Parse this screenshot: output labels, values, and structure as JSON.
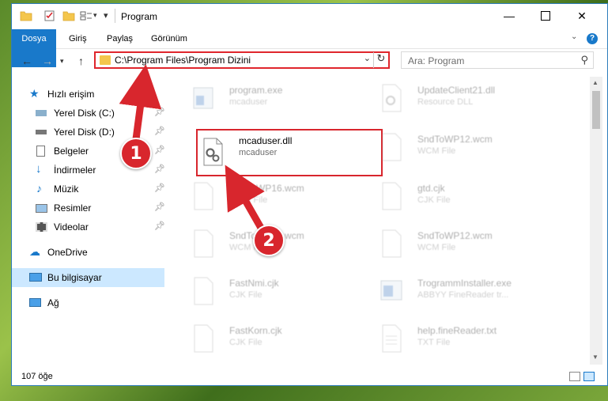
{
  "window": {
    "title": "Program"
  },
  "ribbon": {
    "tabs": [
      "Dosya",
      "Giriş",
      "Paylaş",
      "Görünüm"
    ]
  },
  "address": {
    "path": "C:\\Program Files\\Program Dizini"
  },
  "search": {
    "placeholder": "Ara: Program"
  },
  "sidebar": {
    "items": [
      {
        "label": "Hızlı erişim",
        "icon": "star-icon",
        "pinned": false
      },
      {
        "label": "Yerel Disk (C:)",
        "icon": "drive-icon",
        "pinned": true
      },
      {
        "label": "Yerel Disk (D:)",
        "icon": "drive-icon",
        "pinned": true
      },
      {
        "label": "Belgeler",
        "icon": "documents-icon",
        "pinned": true
      },
      {
        "label": "İndirmeler",
        "icon": "download-icon",
        "pinned": true
      },
      {
        "label": "Müzik",
        "icon": "music-icon",
        "pinned": true
      },
      {
        "label": "Resimler",
        "icon": "pictures-icon",
        "pinned": true
      },
      {
        "label": "Videolar",
        "icon": "videos-icon",
        "pinned": true
      },
      {
        "label": "OneDrive",
        "icon": "cloud-icon",
        "pinned": false
      },
      {
        "label": "Bu bilgisayar",
        "icon": "computer-icon",
        "pinned": false,
        "selected": true
      },
      {
        "label": "Ağ",
        "icon": "network-icon",
        "pinned": false
      }
    ]
  },
  "files": [
    {
      "name": "program.exe",
      "type": "mcaduser",
      "faded": true,
      "icon": "exe-icon"
    },
    {
      "name": "UpdateClient21.dll",
      "type": "Resource DLL",
      "faded": true,
      "icon": "dll-icon"
    },
    {
      "name": "mcaduser.dll",
      "type": "mcaduser",
      "faded": false,
      "highlight": true,
      "icon": "dll-icon"
    },
    {
      "name": "SndToWP12.wcm",
      "type": "WCM File",
      "faded": true,
      "icon": "file-icon"
    },
    {
      "name": "SndToWP16.wcm",
      "type": "WCM File",
      "faded": true,
      "icon": "file-icon"
    },
    {
      "name": "gtd.cjk",
      "type": "CJK File",
      "faded": true,
      "icon": "file-icon"
    },
    {
      "name": "SndToWP12.wcm",
      "type": "WCM File",
      "faded": true,
      "icon": "file-icon"
    },
    {
      "name": "SndToWP12.wcm",
      "type": "WCM File",
      "faded": true,
      "icon": "file-icon"
    },
    {
      "name": "FastNmi.cjk",
      "type": "CJK File",
      "faded": true,
      "icon": "file-icon"
    },
    {
      "name": "TrogrammInstaller.exe",
      "type": "ABBYY FineReader tr...",
      "faded": true,
      "icon": "exe-icon"
    },
    {
      "name": "FastKorn.cjk",
      "type": "CJK File",
      "faded": true,
      "icon": "file-icon"
    },
    {
      "name": "help.fineReader.txt",
      "type": "TXT File",
      "faded": true,
      "icon": "file-icon"
    }
  ],
  "status": {
    "count": "107 öğe"
  },
  "annotations": {
    "badge1": "1",
    "badge2": "2"
  },
  "colors": {
    "accent": "#1979ca",
    "highlight": "#d8262d",
    "selected": "#cce8ff"
  }
}
